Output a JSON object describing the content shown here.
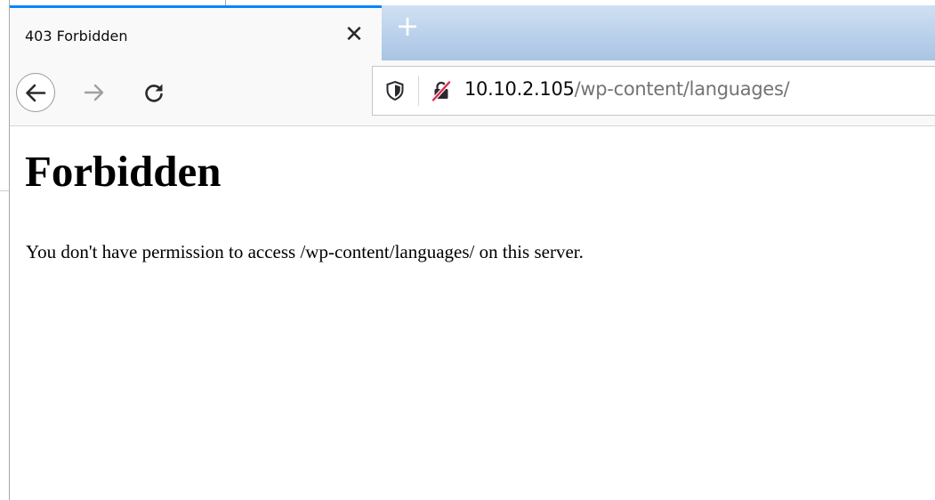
{
  "browser": {
    "tab": {
      "title": "403 Forbidden",
      "close_glyph": "✕",
      "close_icon": "close-icon"
    },
    "new_tab": {
      "glyph": "+",
      "icon": "plus-icon"
    },
    "nav": {
      "back_icon": "back-arrow-icon",
      "forward_icon": "forward-arrow-icon",
      "reload_icon": "reload-icon"
    },
    "url": {
      "host": "10.10.2.105",
      "path": "/wp-content/languages/",
      "tracking_protection_icon": "shield-icon",
      "connection_icon": "insecure-lock-icon"
    },
    "accent_color": "#0a84ff",
    "insecure_color": "#e22850"
  },
  "page": {
    "heading": "Forbidden",
    "message": "You don't have permission to access /wp-content/languages/ on this server."
  }
}
